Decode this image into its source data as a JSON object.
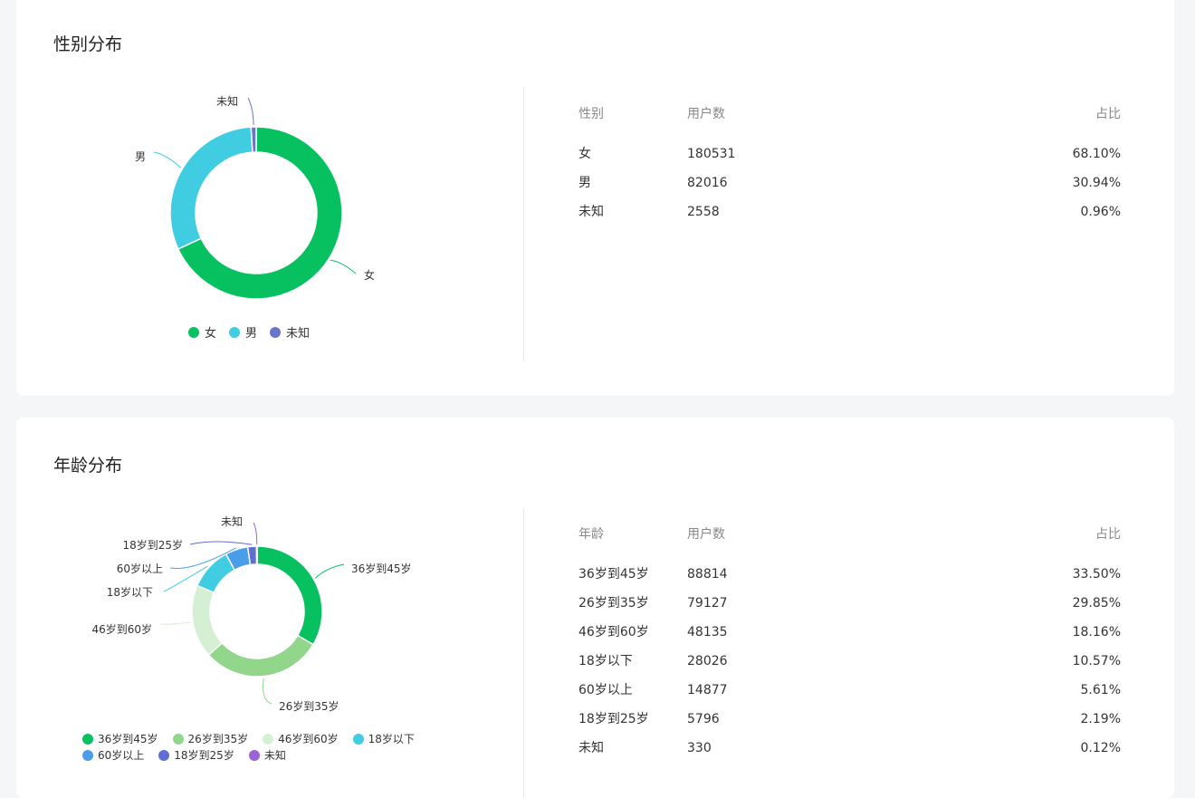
{
  "gender_section": {
    "title": "性别分布",
    "table": {
      "headers": [
        "性别",
        "用户数",
        "占比"
      ],
      "rows": [
        [
          "女",
          "180531",
          "68.10%"
        ],
        [
          "男",
          "82016",
          "30.94%"
        ],
        [
          "未知",
          "2558",
          "0.96%"
        ]
      ]
    }
  },
  "age_section": {
    "title": "年龄分布",
    "table": {
      "headers": [
        "年龄",
        "用户数",
        "占比"
      ],
      "rows": [
        [
          "36岁到45岁",
          "88814",
          "33.50%"
        ],
        [
          "26岁到35岁",
          "79127",
          "29.85%"
        ],
        [
          "46岁到60岁",
          "48135",
          "18.16%"
        ],
        [
          "18岁以下",
          "28026",
          "10.57%"
        ],
        [
          "60岁以上",
          "14877",
          "5.61%"
        ],
        [
          "18岁到25岁",
          "5796",
          "2.19%"
        ],
        [
          "未知",
          "330",
          "0.12%"
        ]
      ]
    }
  },
  "chart_data": [
    {
      "type": "pie",
      "categories": [
        "女",
        "男",
        "未知"
      ],
      "values": [
        180531,
        82016,
        2558
      ],
      "colors": [
        "#07c160",
        "#40cde1",
        "#6b73d0"
      ],
      "legend_placement": "bottom"
    },
    {
      "type": "pie",
      "categories": [
        "36岁到45岁",
        "26岁到35岁",
        "46岁到60岁",
        "18岁以下",
        "60岁以上",
        "18岁到25岁",
        "未知"
      ],
      "values": [
        88814,
        79127,
        48135,
        28026,
        14877,
        5796,
        330
      ],
      "colors": [
        "#07c160",
        "#91d68a",
        "#d4efd3",
        "#40cde1",
        "#4a9de8",
        "#5f6fd1",
        "#9b63d8"
      ],
      "legend_placement": "bottom"
    }
  ]
}
